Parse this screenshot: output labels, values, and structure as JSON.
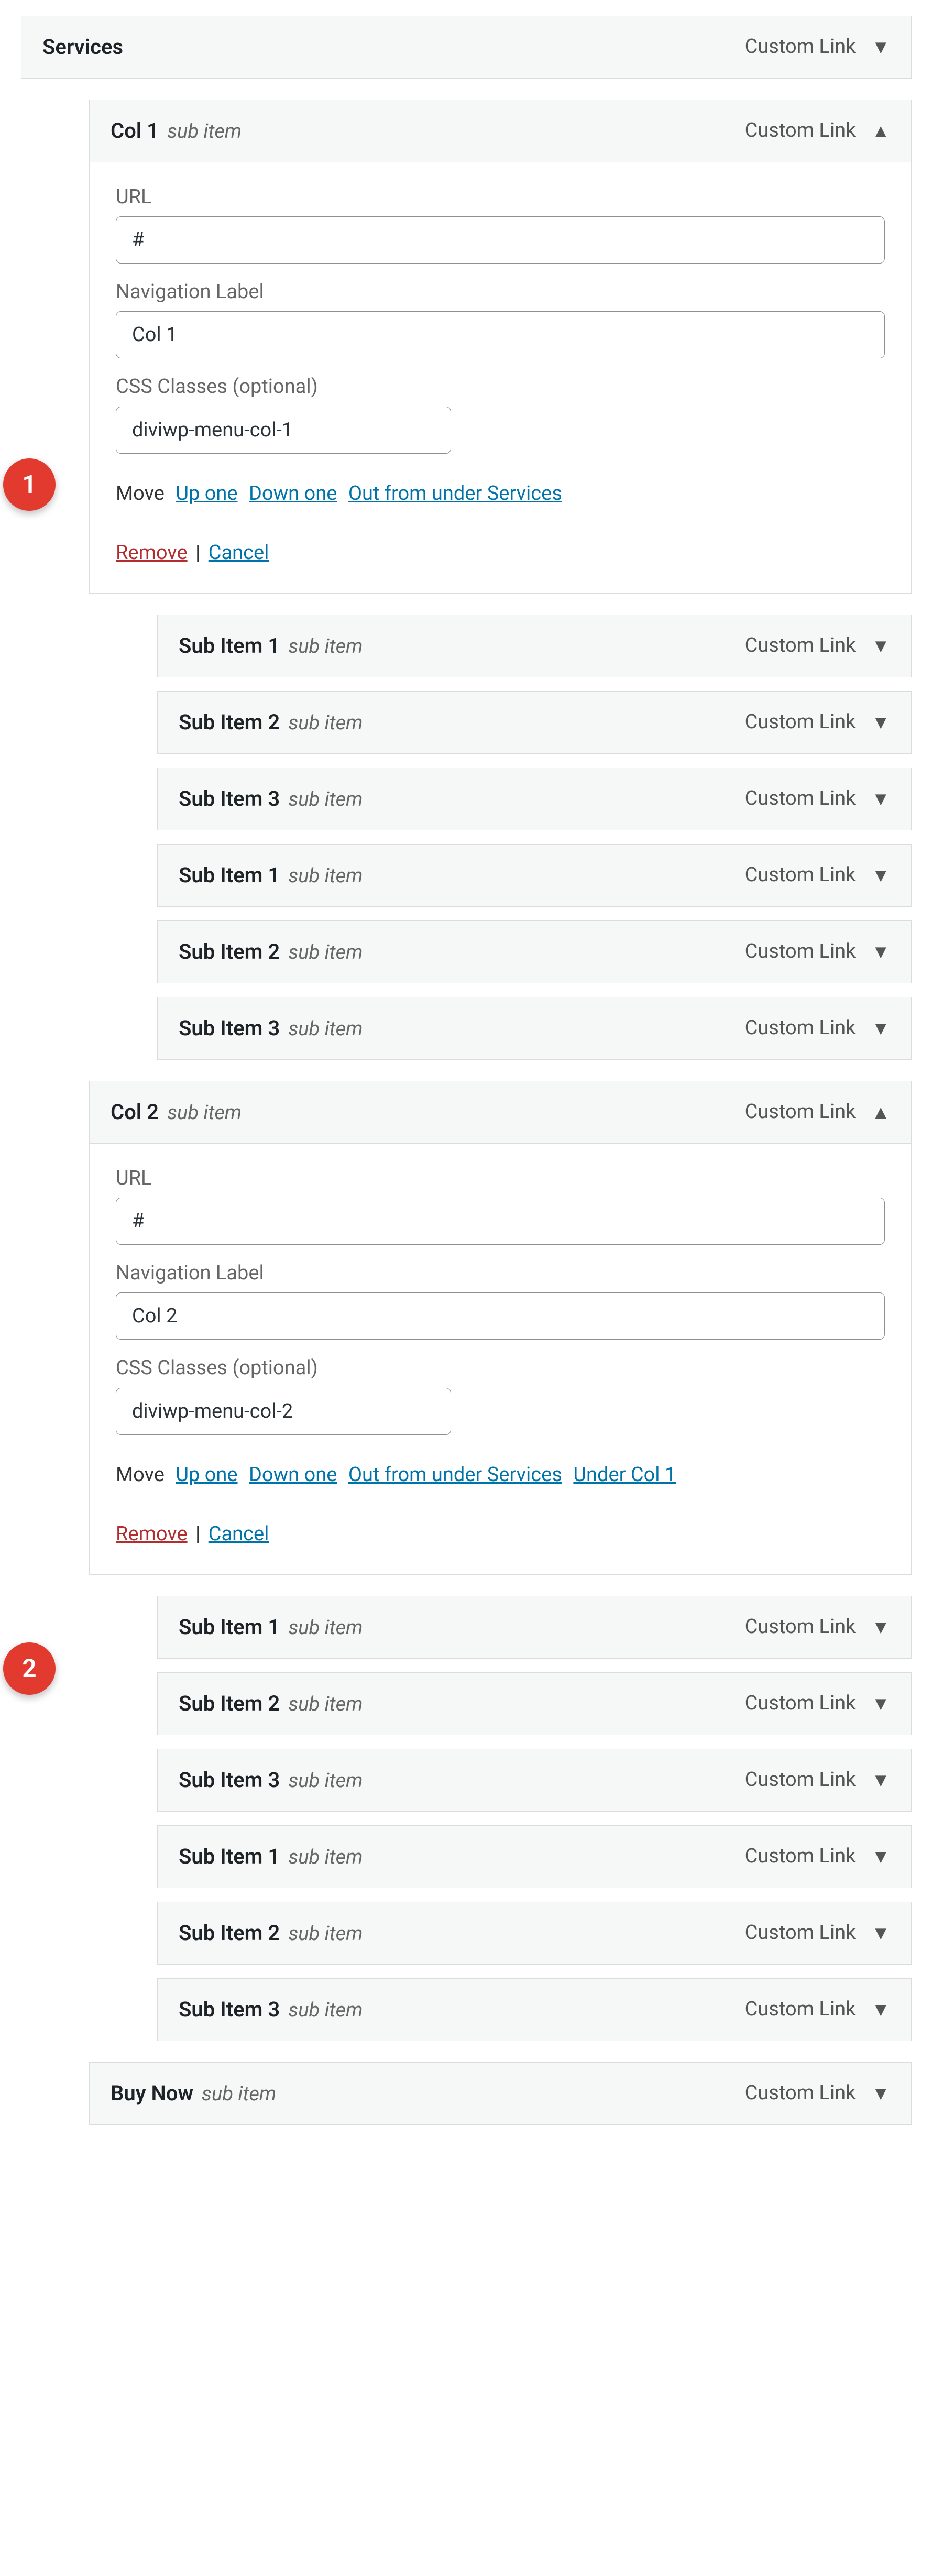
{
  "common": {
    "custom_link": "Custom Link",
    "sub_item": "sub item",
    "url_label": "URL",
    "nav_label": "Navigation Label",
    "css_label": "CSS Classes (optional)",
    "move_label": "Move",
    "up_one": "Up one",
    "down_one": "Down one",
    "out_from_under_services": "Out from under Services",
    "under_col1": "Under Col 1",
    "remove": "Remove",
    "sep": " | ",
    "cancel": "Cancel"
  },
  "markers": {
    "one": "1",
    "two": "2"
  },
  "top": {
    "title": "Services"
  },
  "col1": {
    "title": "Col 1",
    "url_value": "#",
    "nav_value": "Col 1",
    "css_value": "diviwp-menu-col-1"
  },
  "col2": {
    "title": "Col 2",
    "url_value": "#",
    "nav_value": "Col 2",
    "css_value": "diviwp-menu-col-2"
  },
  "sub_set_a": [
    {
      "title": "Sub Item 1"
    },
    {
      "title": "Sub Item 2"
    },
    {
      "title": "Sub Item 3"
    },
    {
      "title": "Sub Item 1"
    },
    {
      "title": "Sub Item 2"
    },
    {
      "title": "Sub Item 3"
    }
  ],
  "sub_set_b": [
    {
      "title": "Sub Item 1"
    },
    {
      "title": "Sub Item 2"
    },
    {
      "title": "Sub Item 3"
    },
    {
      "title": "Sub Item 1"
    },
    {
      "title": "Sub Item 2"
    },
    {
      "title": "Sub Item 3"
    }
  ],
  "buy_now": {
    "title": "Buy Now"
  }
}
